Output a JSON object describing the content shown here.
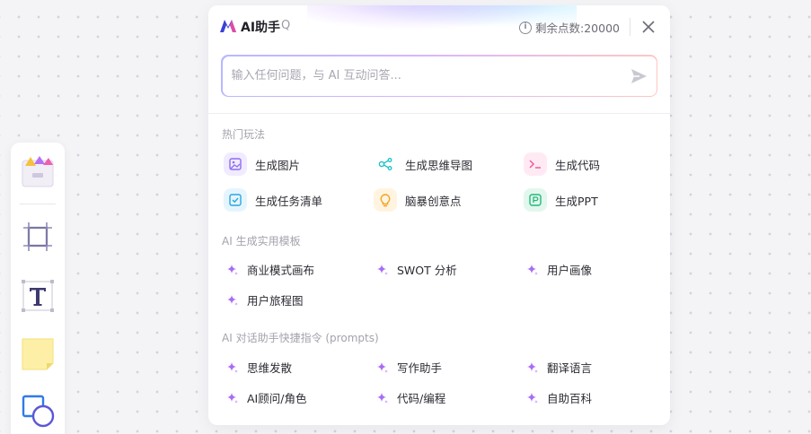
{
  "header": {
    "title": "AI助手",
    "shortcut": "Q",
    "points_label": "剩余点数:20000"
  },
  "input": {
    "placeholder": "输入任何问题，与 AI 互动问答..."
  },
  "sections": {
    "hot": {
      "title": "热门玩法",
      "items": [
        {
          "label": "生成图片",
          "icon": "image-icon",
          "color": "#8e6cf0"
        },
        {
          "label": "生成思维导图",
          "icon": "mindmap-icon",
          "color": "#1fc0c8"
        },
        {
          "label": "生成代码",
          "icon": "code-icon",
          "color": "#f25c9a"
        },
        {
          "label": "生成任务清单",
          "icon": "checklist-icon",
          "color": "#2aa7e0"
        },
        {
          "label": "脑暴创意点",
          "icon": "lightbulb-icon",
          "color": "#f4a11f"
        },
        {
          "label": "生成PPT",
          "icon": "ppt-icon",
          "color": "#23b979"
        }
      ]
    },
    "templates": {
      "title": "AI 生成实用模板",
      "items": [
        "商业模式画布",
        "SWOT 分析",
        "用户画像",
        "用户旅程图"
      ]
    },
    "prompts": {
      "title": "AI 对话助手快捷指令 (prompts)",
      "items": [
        "思维发散",
        "写作助手",
        "翻译语言",
        "AI顾问/角色",
        "代码/编程",
        "自助百科"
      ]
    }
  },
  "toolbar": {
    "tools": [
      "template-icon",
      "frame-icon",
      "text-icon",
      "sticky-note-icon",
      "shape-icon"
    ]
  }
}
